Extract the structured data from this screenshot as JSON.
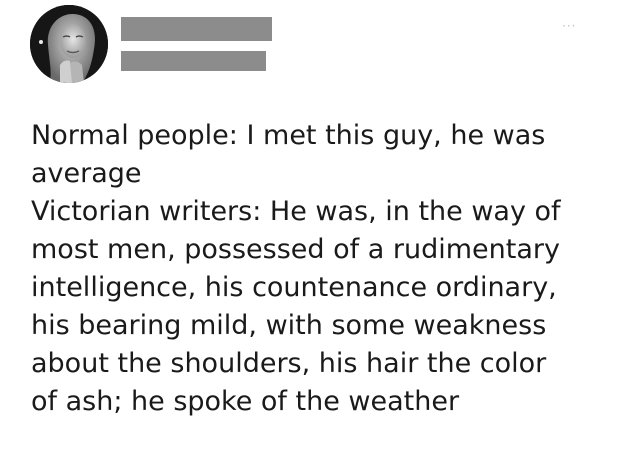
{
  "tweet": {
    "menu_label": "···",
    "text_lines": [
      "Normal people: I met this guy, he was",
      "average",
      "Victorian writers: He was, in the way of",
      "most men, possessed of a rudimentary",
      "intelligence, his countenance ordinary,",
      "his bearing mild, with some weakness",
      "about the shoulders, his hair the color",
      "of ash; he spoke of the weather"
    ]
  },
  "colors": {
    "text": "#1a1a1a",
    "redaction": "#8c8c8c",
    "background": "#ffffff"
  }
}
